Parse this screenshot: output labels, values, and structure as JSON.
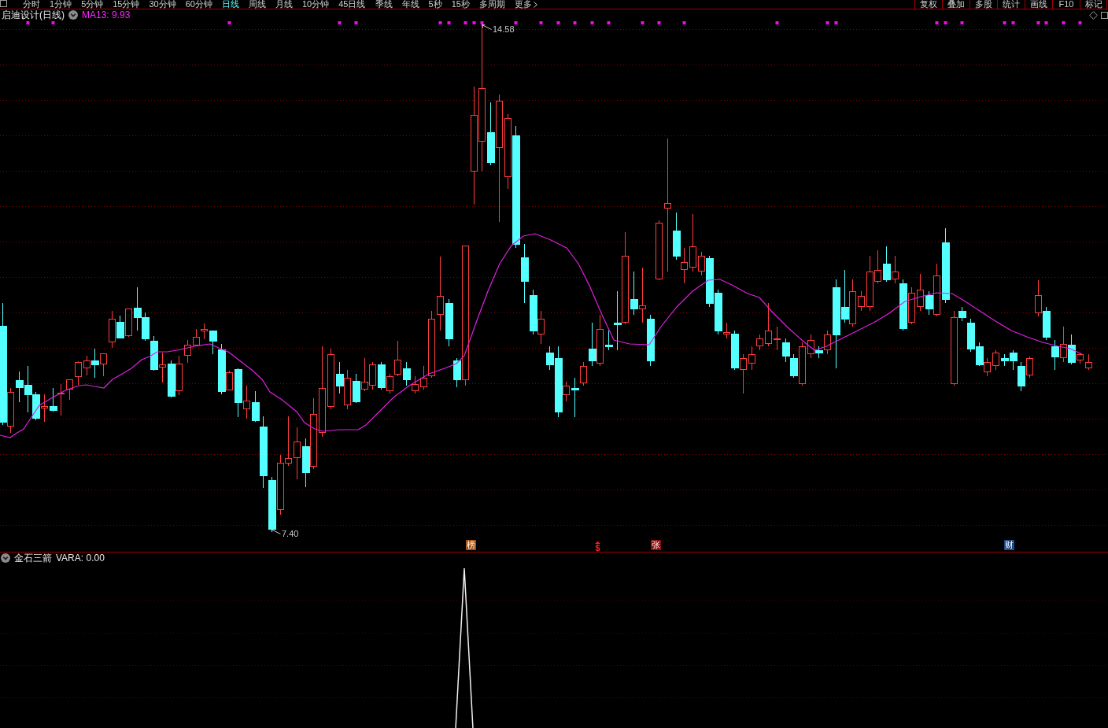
{
  "toolbar": {
    "periods": [
      {
        "label": "分时",
        "kind": "period",
        "selected": false
      },
      {
        "label": "1分钟",
        "kind": "period",
        "selected": false
      },
      {
        "label": "5分钟",
        "kind": "period",
        "selected": false
      },
      {
        "label": "15分钟",
        "kind": "period",
        "selected": false
      },
      {
        "label": "30分钟",
        "kind": "period",
        "selected": false
      },
      {
        "label": "60分钟",
        "kind": "period",
        "selected": false
      },
      {
        "label": "日线",
        "kind": "period",
        "selected": true
      },
      {
        "label": "周线",
        "kind": "period",
        "selected": false
      },
      {
        "label": "月线",
        "kind": "period",
        "selected": false
      },
      {
        "label": "10分钟",
        "kind": "period",
        "selected": false
      },
      {
        "label": "45日线",
        "kind": "period",
        "selected": false
      },
      {
        "label": "季线",
        "kind": "period",
        "selected": false
      },
      {
        "label": "年线",
        "kind": "period",
        "selected": false
      },
      {
        "label": "5秒",
        "kind": "period",
        "selected": false
      },
      {
        "label": "15秒",
        "kind": "period",
        "selected": false
      },
      {
        "label": "多周期",
        "kind": "period",
        "selected": false
      },
      {
        "label": "更多",
        "kind": "menu",
        "selected": false
      }
    ],
    "tools": [
      "复权",
      "叠加",
      "多股",
      "统计",
      "画线",
      "F10",
      "标记"
    ]
  },
  "main_chart": {
    "title": "启迪设计(日线)",
    "ma_reading": "MA13: 9.93",
    "high_label": "14.58",
    "low_label": "7.40",
    "event_markers": [
      {
        "label": "榜",
        "kind": "tile",
        "color": "#a8520f"
      },
      {
        "label": "$",
        "kind": "glyph",
        "color": "#ff2020"
      },
      {
        "label": "张",
        "kind": "tile",
        "color": "#8c0c0c"
      },
      {
        "label": "财",
        "kind": "tile",
        "color": "#1c4a86"
      }
    ]
  },
  "indicator_panel": {
    "title": "金石三箭",
    "reading": "VARA: 0.00"
  }
}
